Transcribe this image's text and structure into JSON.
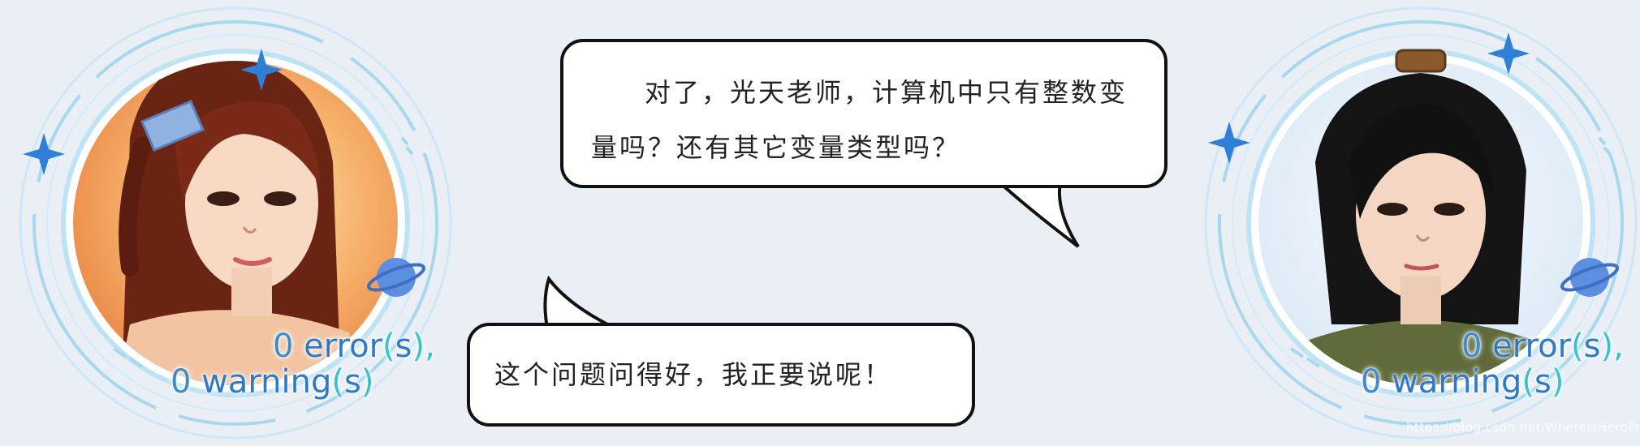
{
  "left_character": {
    "badge_line1": {
      "num": "0",
      "word": "error",
      "open": "(",
      "suffix": "s",
      "close": "),"
    },
    "badge_line2": {
      "num": "0",
      "word": "warning",
      "open": "(",
      "suffix": "s",
      "close": ")"
    }
  },
  "right_character": {
    "badge_line1": {
      "num": "0",
      "word": "error",
      "open": "(",
      "suffix": "s",
      "close": "),"
    },
    "badge_line2": {
      "num": "0",
      "word": "warning",
      "open": "(",
      "suffix": "s",
      "close": ")"
    }
  },
  "dialogue": {
    "top_bubble": "对了，光天老师，计算机中只有整数变量吗？还有其它变量类型吗？",
    "bottom_bubble": "这个问题问得好，我正要说呢！"
  },
  "watermark": "https://blog.csdn.net/WhereIsHeroFrom",
  "colors": {
    "background": "#e9eff5",
    "badge_blue": "#2f79c6",
    "badge_teal": "#38c2c9",
    "ring_blue": "#9fd3ee",
    "sparkle": "#2f7fd8"
  }
}
